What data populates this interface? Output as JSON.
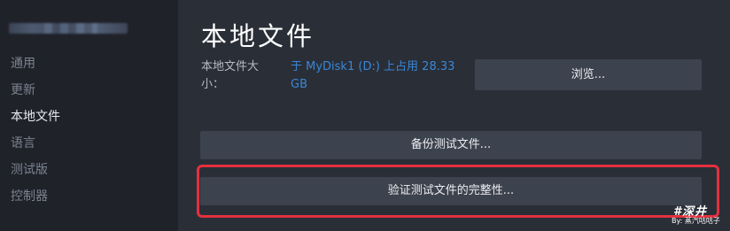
{
  "sidebar": {
    "items": [
      {
        "label": "通用",
        "active": false
      },
      {
        "label": "更新",
        "active": false
      },
      {
        "label": "本地文件",
        "active": true
      },
      {
        "label": "语言",
        "active": false
      },
      {
        "label": "测试版",
        "active": false
      },
      {
        "label": "控制器",
        "active": false
      }
    ]
  },
  "main": {
    "title": "本地文件",
    "size_label": "本地文件大小：",
    "size_value": "于 MyDisk1 (D:) 上占用 28.33 GB",
    "browse_label": "浏览...",
    "backup_label": "备份测试文件...",
    "verify_label": "验证测试文件的完整性..."
  },
  "watermark": {
    "logo": "#深井",
    "sub": "By: 蒸汽咕咕子"
  },
  "colors": {
    "background": "#2a2e37",
    "sidebar": "#1f2229",
    "button": "#3d434e",
    "link": "#3a87d6",
    "highlight": "#e4303e"
  }
}
